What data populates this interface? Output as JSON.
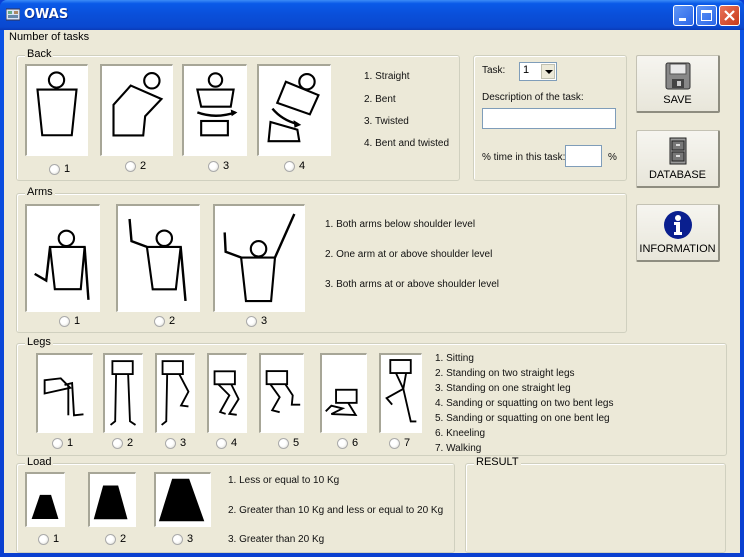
{
  "window": {
    "title": "OWAS",
    "icon": "app-icon"
  },
  "menu": {
    "label": "Number of tasks"
  },
  "back": {
    "legend": "Back",
    "options": [
      {
        "label": "1",
        "icon": "back-straight-icon"
      },
      {
        "label": "2",
        "icon": "back-bent-icon"
      },
      {
        "label": "3",
        "icon": "back-twisted-icon"
      },
      {
        "label": "4",
        "icon": "back-bent-twisted-icon"
      }
    ],
    "descriptions": [
      "1. Straight",
      "2. Bent",
      "3. Twisted",
      "4. Bent and twisted"
    ]
  },
  "task": {
    "task_label": "Task:",
    "task_value": "1",
    "description_label": "Description of the task:",
    "description_value": "",
    "time_label": "% time in this task:",
    "time_value": "",
    "percent_sign": "%"
  },
  "buttons": {
    "save": "SAVE",
    "database": "DATABASE",
    "information": "INFORMATION"
  },
  "arms": {
    "legend": "Arms",
    "options": [
      {
        "label": "1"
      },
      {
        "label": "2"
      },
      {
        "label": "3"
      }
    ],
    "descriptions": [
      "1. Both arms below shoulder level",
      "2. One arm at or above shoulder level",
      "3. Both arms at or above shoulder level"
    ]
  },
  "legs": {
    "legend": "Legs",
    "options": [
      {
        "label": "1"
      },
      {
        "label": "2"
      },
      {
        "label": "3"
      },
      {
        "label": "4"
      },
      {
        "label": "5"
      },
      {
        "label": "6"
      },
      {
        "label": "7"
      }
    ],
    "descriptions": [
      "1. Sitting",
      "2. Standing on two straight legs",
      "3. Standing on one straight leg",
      "4. Sanding or squatting on two bent legs",
      "5. Sanding or squatting on one bent leg",
      "6. Kneeling",
      "7. Walking"
    ]
  },
  "load": {
    "legend": "Load",
    "options": [
      {
        "label": "1"
      },
      {
        "label": "2"
      },
      {
        "label": "3"
      }
    ],
    "descriptions": [
      "1. Less or equal to 10 Kg",
      "2. Greater than 10 Kg and less or equal to 20 Kg",
      "3. Greater than 20 Kg"
    ]
  },
  "result": {
    "legend": "RESULT",
    "value": ""
  }
}
